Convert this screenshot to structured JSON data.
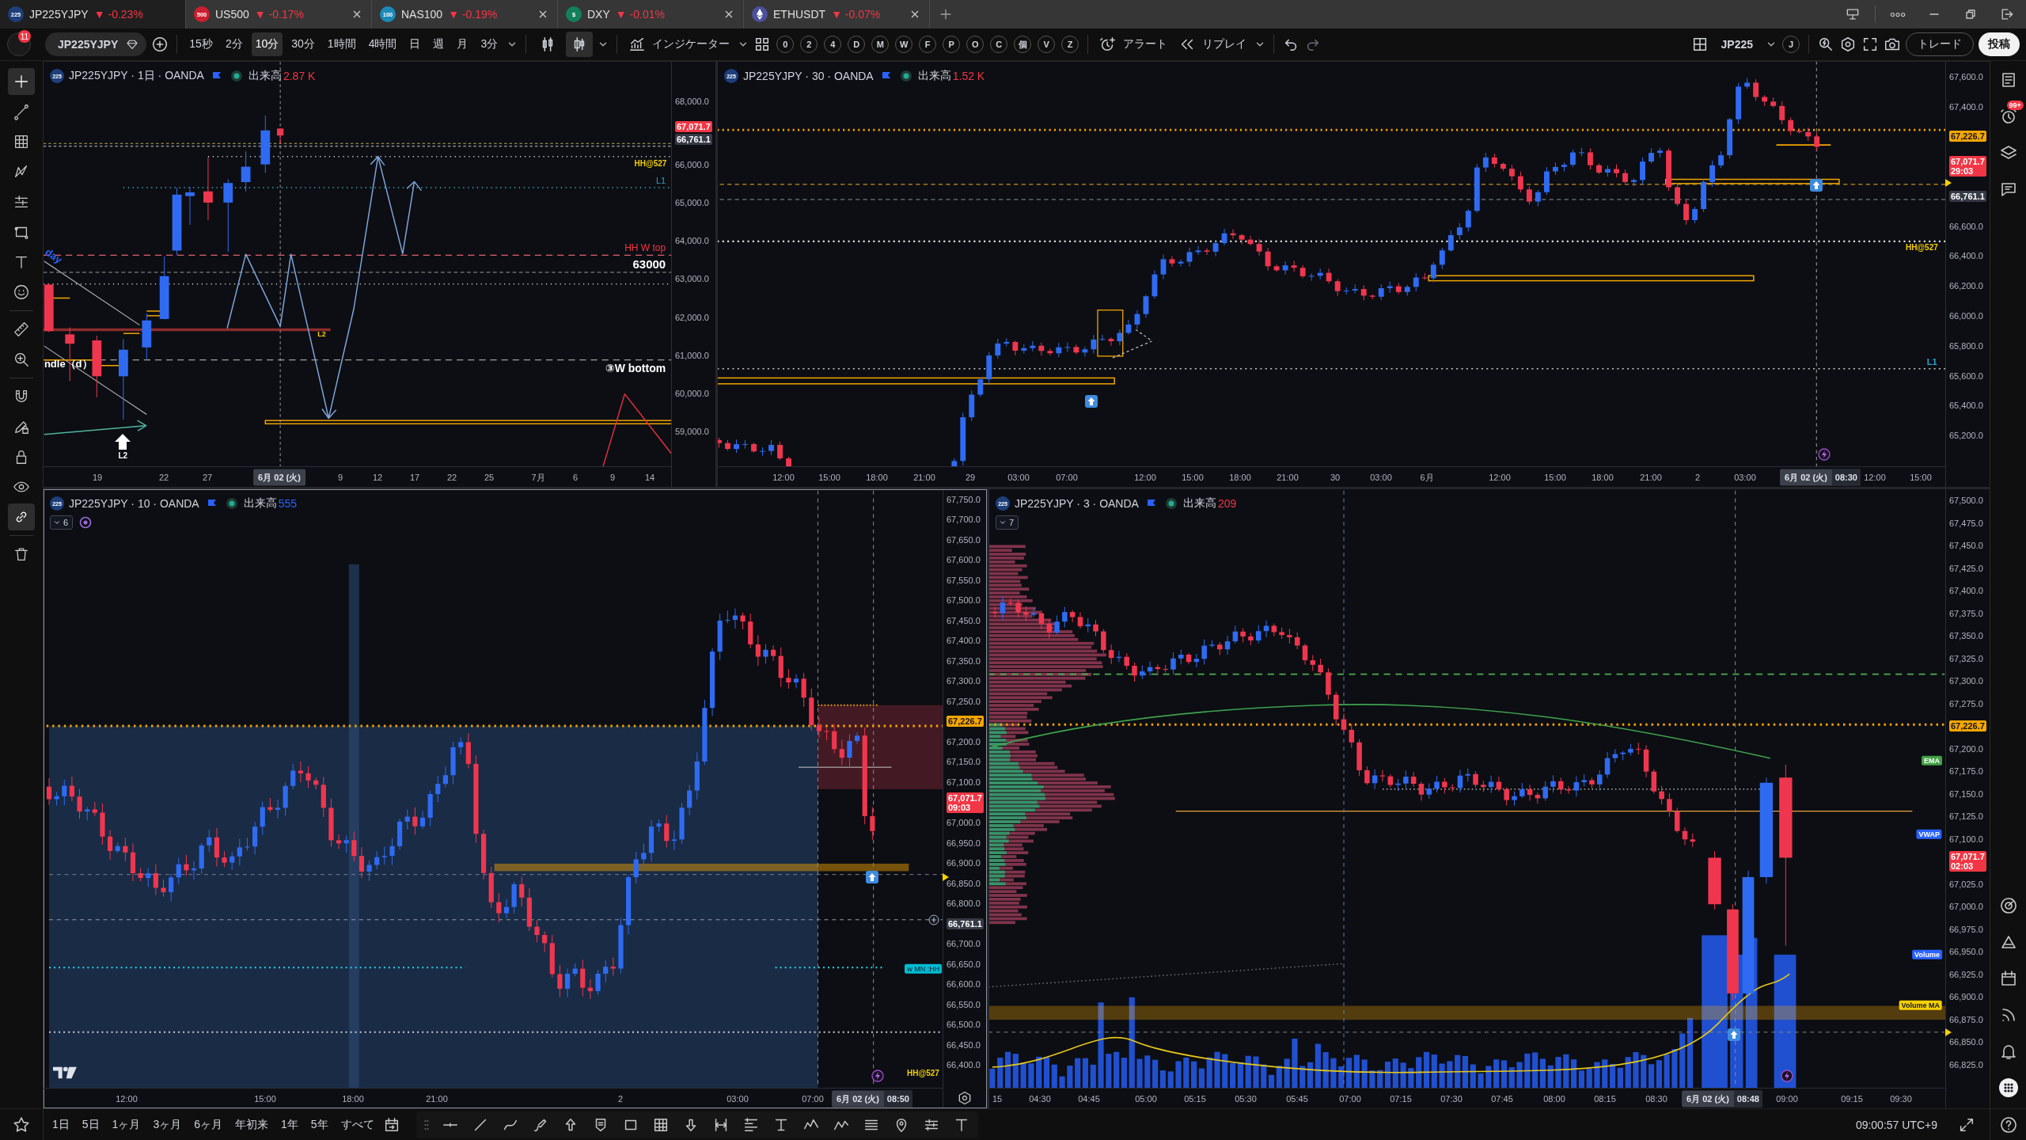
{
  "tabs": [
    {
      "kind": "text",
      "badge": "225",
      "symbol": "JP225YJPY",
      "change": "▼ -0.23%",
      "color": "#1e3f7a",
      "selected": true
    },
    {
      "kind": "text",
      "badge": "500",
      "symbol": "US500",
      "change": "▼ -0.17%",
      "color": "#cc1f2f",
      "selected": false
    },
    {
      "kind": "text",
      "badge": "100",
      "symbol": "NAS100",
      "change": "▼ -0.19%",
      "color": "#1c8ab8",
      "selected": false
    },
    {
      "kind": "text",
      "badge": "$",
      "symbol": "DXY",
      "change": "▼ -0.01%",
      "color": "#13805a",
      "selected": false
    },
    {
      "kind": "icon",
      "symbol": "ETHUSDT",
      "change": "▼ -0.07%",
      "color": "#4b4f9c",
      "selected": false
    }
  ],
  "toolbar": {
    "notifications": "11",
    "symbol": "JP225YJPY",
    "intervals": [
      {
        "label": "15秒",
        "selected": false
      },
      {
        "label": "2分",
        "selected": false
      },
      {
        "label": "10分",
        "selected": true
      },
      {
        "label": "30分",
        "selected": false
      },
      {
        "label": "1時間",
        "selected": false
      },
      {
        "label": "4時間",
        "selected": false
      },
      {
        "label": "日",
        "selected": false
      },
      {
        "label": "週",
        "selected": false
      },
      {
        "label": "月",
        "selected": false
      },
      {
        "label": "3分",
        "selected": false
      }
    ],
    "chart_styles": [
      {
        "selected": false
      },
      {
        "selected": true
      }
    ],
    "indicators": "インジケーター",
    "shortcuts": [
      "0",
      "2",
      "4",
      "D",
      "M",
      "W",
      "F",
      "P",
      "O",
      "C",
      "個",
      "V",
      "Z"
    ],
    "alert": "アラート",
    "replay": "リプレイ",
    "layout_symbol": "JP225",
    "layout_badge": "J",
    "trade": "トレード",
    "publish": "投稿"
  },
  "left_tools": [
    {
      "selected": true
    },
    {
      "selected": false
    },
    {
      "selected": false
    },
    {
      "selected": false
    },
    {
      "selected": false
    },
    {
      "selected": false
    },
    {
      "selected": false
    },
    {
      "selected": false
    },
    {
      "selected": false
    },
    {
      "selected": false
    },
    {
      "selected": false
    },
    {
      "selected": false
    },
    {
      "selected": false
    },
    {
      "selected": false
    },
    {
      "selected": true
    },
    {
      "selected": false
    }
  ],
  "panes": [
    {
      "badge": "225",
      "title": "JP225YJPY · 1日 · OANDA",
      "volume": {
        "label": "出来高",
        "value": "2.87 K",
        "color": "#f23645"
      },
      "selected": false,
      "price_axis": [
        {
          "kind": "tick",
          "text": "68,000.0"
        },
        {
          "kind": "tag",
          "text": "67,071.7",
          "color": "#f23645"
        },
        {
          "kind": "tag",
          "text": "66,761.1",
          "color": "#363a45"
        },
        {
          "kind": "tick",
          "text": "66,000.0"
        },
        {
          "kind": "tick",
          "text": "65,000.0"
        },
        {
          "kind": "tick",
          "text": "64,000.0"
        },
        {
          "kind": "tick",
          "text": "63,000.0"
        },
        {
          "kind": "tick",
          "text": "62,000.0"
        },
        {
          "kind": "tick",
          "text": "61,000.0"
        },
        {
          "kind": "tick",
          "text": "60,000.0"
        },
        {
          "kind": "tick",
          "text": "59,000.0"
        }
      ],
      "time_axis": [
        {
          "kind": "tick",
          "text": "19"
        },
        {
          "kind": "tick",
          "text": "22"
        },
        {
          "kind": "tick",
          "text": "27"
        },
        {
          "kind": "cursor",
          "text": "6月 02 (火)"
        },
        {
          "kind": "tick",
          "text": "9"
        },
        {
          "kind": "tick",
          "text": "12"
        },
        {
          "kind": "tick",
          "text": "17"
        },
        {
          "kind": "tick",
          "text": "22"
        },
        {
          "kind": "tick",
          "text": "25"
        },
        {
          "kind": "tick",
          "text": "7月"
        },
        {
          "kind": "tick",
          "text": "6"
        },
        {
          "kind": "tick",
          "text": "9"
        },
        {
          "kind": "tick",
          "text": "14"
        }
      ],
      "annotations": [
        {
          "kind": "text",
          "text": "HH@527",
          "color": "#f5d000"
        },
        {
          "kind": "text",
          "text": "L1",
          "color": "#26a6c9"
        },
        {
          "kind": "text",
          "text": "HH W top",
          "color": "#f23645"
        },
        {
          "kind": "text",
          "text": "63000",
          "color": "#ffffff"
        },
        {
          "kind": "text",
          "text": "L2",
          "color": "#f5d000"
        },
        {
          "kind": "text",
          "text": "③W bottom",
          "color": "#ffffff"
        },
        {
          "kind": "text",
          "text": "ndle（d）",
          "color": "#ffffff"
        },
        {
          "kind": "text",
          "text": "L2",
          "color": "#ffffff"
        },
        {
          "kind": "text",
          "text": "day",
          "color": "#2962ff"
        }
      ]
    },
    {
      "badge": "225",
      "title": "JP225YJPY · 30 · OANDA",
      "volume": {
        "label": "出来高",
        "value": "1.52 K",
        "color": "#f23645"
      },
      "selected": false,
      "price_axis": [
        {
          "kind": "tick",
          "text": "67,600.0"
        },
        {
          "kind": "tick",
          "text": "67,400.0"
        },
        {
          "kind": "tag",
          "text": "67,226.7",
          "color": "#f7a600"
        },
        {
          "kind": "tag",
          "text": "67,071.7",
          "sub": "29:03",
          "color": "#f23645"
        },
        {
          "kind": "tag",
          "text": "66,761.1",
          "color": "#363a45"
        },
        {
          "kind": "tick",
          "text": "66,600.0"
        },
        {
          "kind": "tick",
          "text": "66,400.0"
        },
        {
          "kind": "tick",
          "text": "66,200.0"
        },
        {
          "kind": "tick",
          "text": "66,000.0"
        },
        {
          "kind": "tick",
          "text": "65,800.0"
        },
        {
          "kind": "tick",
          "text": "65,600.0"
        },
        {
          "kind": "tick",
          "text": "65,400.0"
        },
        {
          "kind": "tick",
          "text": "65,200.0"
        }
      ],
      "time_axis": [
        {
          "kind": "tick",
          "text": "12:00"
        },
        {
          "kind": "tick",
          "text": "15:00"
        },
        {
          "kind": "tick",
          "text": "18:00"
        },
        {
          "kind": "tick",
          "text": "21:00"
        },
        {
          "kind": "tick",
          "text": "29"
        },
        {
          "kind": "tick",
          "text": "03:00"
        },
        {
          "kind": "tick",
          "text": "07:00"
        },
        {
          "kind": "tick",
          "text": "12:00"
        },
        {
          "kind": "tick",
          "text": "15:00"
        },
        {
          "kind": "tick",
          "text": "18:00"
        },
        {
          "kind": "tick",
          "text": "21:00"
        },
        {
          "kind": "tick",
          "text": "30"
        },
        {
          "kind": "tick",
          "text": "03:00"
        },
        {
          "kind": "tick",
          "text": "6月"
        },
        {
          "kind": "tick",
          "text": "12:00"
        },
        {
          "kind": "tick",
          "text": "15:00"
        },
        {
          "kind": "tick",
          "text": "18:00"
        },
        {
          "kind": "tick",
          "text": "21:00"
        },
        {
          "kind": "tick",
          "text": "2"
        },
        {
          "kind": "tick",
          "text": "03:00"
        },
        {
          "kind": "cursor",
          "text": "6月 02 (火)",
          "time": "08:30"
        },
        {
          "kind": "tick",
          "text": "12:00"
        },
        {
          "kind": "tick",
          "text": "15:00"
        }
      ],
      "annotations": [
        {
          "kind": "text",
          "text": "HH@527",
          "color": "#f5d000"
        },
        {
          "kind": "text",
          "text": "L1",
          "color": "#26a6c9"
        }
      ]
    },
    {
      "badge": "225",
      "title": "JP225YJPY · 10 · OANDA",
      "volume": {
        "label": "出来高",
        "value": "555",
        "color": "#2962ff"
      },
      "indicator_count": "6",
      "selected": true,
      "price_axis": [
        {
          "kind": "tick",
          "text": "67,750.0"
        },
        {
          "kind": "tick",
          "text": "67,700.0"
        },
        {
          "kind": "tick",
          "text": "67,650.0"
        },
        {
          "kind": "tick",
          "text": "67,600.0"
        },
        {
          "kind": "tick",
          "text": "67,550.0"
        },
        {
          "kind": "tick",
          "text": "67,500.0"
        },
        {
          "kind": "tick",
          "text": "67,450.0"
        },
        {
          "kind": "tick",
          "text": "67,400.0"
        },
        {
          "kind": "tick",
          "text": "67,350.0"
        },
        {
          "kind": "tick",
          "text": "67,300.0"
        },
        {
          "kind": "tick",
          "text": "67,250.0"
        },
        {
          "kind": "tag",
          "text": "67,226.7",
          "color": "#f7a600"
        },
        {
          "kind": "tick",
          "text": "67,200.0"
        },
        {
          "kind": "tick",
          "text": "67,150.0"
        },
        {
          "kind": "tick",
          "text": "67,100.0"
        },
        {
          "kind": "tag",
          "text": "67,071.7",
          "sub": "09:03",
          "color": "#f23645"
        },
        {
          "kind": "tick",
          "text": "67,000.0"
        },
        {
          "kind": "tick",
          "text": "66,950.0"
        },
        {
          "kind": "tick",
          "text": "66,900.0"
        },
        {
          "kind": "tick",
          "text": "66,850.0"
        },
        {
          "kind": "tick",
          "text": "66,800.0"
        },
        {
          "kind": "tag",
          "text": "66,761.1",
          "color": "#363a45"
        },
        {
          "kind": "tick",
          "text": "66,700.0"
        },
        {
          "kind": "tick",
          "text": "66,650.0"
        },
        {
          "kind": "tick",
          "text": "66,600.0"
        },
        {
          "kind": "tick",
          "text": "66,550.0"
        },
        {
          "kind": "tick",
          "text": "66,500.0"
        },
        {
          "kind": "tick",
          "text": "66,450.0"
        },
        {
          "kind": "tick",
          "text": "66,400.0"
        }
      ],
      "time_axis": [
        {
          "kind": "tick",
          "text": "12:00"
        },
        {
          "kind": "tick",
          "text": "15:00"
        },
        {
          "kind": "tick",
          "text": "18:00"
        },
        {
          "kind": "tick",
          "text": "21:00"
        },
        {
          "kind": "tick",
          "text": "2"
        },
        {
          "kind": "tick",
          "text": "03:00"
        },
        {
          "kind": "tick",
          "text": "07:00"
        },
        {
          "kind": "cursor",
          "text": "6月 02 (火)",
          "time": "08:50"
        }
      ],
      "annotations": [
        {
          "kind": "tag",
          "text": "w MN :HH",
          "color": "#00bcd4"
        },
        {
          "kind": "text",
          "text": "HH@527",
          "color": "#f5d000"
        }
      ]
    },
    {
      "badge": "225",
      "title": "JP225YJPY · 3 · OANDA",
      "volume": {
        "label": "出来高",
        "value": "209",
        "color": "#f23645"
      },
      "indicator_count": "7",
      "selected": false,
      "price_axis": [
        {
          "kind": "tick",
          "text": "67,500.0"
        },
        {
          "kind": "tick",
          "text": "67,475.0"
        },
        {
          "kind": "tick",
          "text": "67,450.0"
        },
        {
          "kind": "tick",
          "text": "67,425.0"
        },
        {
          "kind": "tick",
          "text": "67,400.0"
        },
        {
          "kind": "tick",
          "text": "67,375.0"
        },
        {
          "kind": "tick",
          "text": "67,350.0"
        },
        {
          "kind": "tick",
          "text": "67,325.0"
        },
        {
          "kind": "tick",
          "text": "67,300.0"
        },
        {
          "kind": "tick",
          "text": "67,275.0"
        },
        {
          "kind": "tag",
          "text": "67,226.7",
          "color": "#f7a600"
        },
        {
          "kind": "tick",
          "text": "67,200.0"
        },
        {
          "kind": "tick",
          "text": "67,175.0"
        },
        {
          "kind": "tick",
          "text": "67,150.0"
        },
        {
          "kind": "tick",
          "text": "67,125.0"
        },
        {
          "kind": "tick",
          "text": "67,100.0"
        },
        {
          "kind": "tag",
          "text": "67,071.7",
          "sub": "02:03",
          "color": "#f23645"
        },
        {
          "kind": "tick",
          "text": "67,025.0"
        },
        {
          "kind": "tick",
          "text": "67,000.0"
        },
        {
          "kind": "tick",
          "text": "66,975.0"
        },
        {
          "kind": "tick",
          "text": "66,950.0"
        },
        {
          "kind": "tick",
          "text": "66,925.0"
        },
        {
          "kind": "tick",
          "text": "66,900.0"
        },
        {
          "kind": "tick",
          "text": "66,875.0"
        },
        {
          "kind": "tick",
          "text": "66,850.0"
        },
        {
          "kind": "tick",
          "text": "66,825.0"
        }
      ],
      "time_axis": [
        {
          "kind": "tick",
          "text": "15"
        },
        {
          "kind": "tick",
          "text": "04:30"
        },
        {
          "kind": "tick",
          "text": "04:45"
        },
        {
          "kind": "tick",
          "text": "05:00"
        },
        {
          "kind": "tick",
          "text": "05:15"
        },
        {
          "kind": "tick",
          "text": "05:30"
        },
        {
          "kind": "tick",
          "text": "05:45"
        },
        {
          "kind": "tick",
          "text": "07:00"
        },
        {
          "kind": "tick",
          "text": "07:15"
        },
        {
          "kind": "tick",
          "text": "07:30"
        },
        {
          "kind": "tick",
          "text": "07:45"
        },
        {
          "kind": "tick",
          "text": "08:00"
        },
        {
          "kind": "tick",
          "text": "08:15"
        },
        {
          "kind": "tick",
          "text": "08:30"
        },
        {
          "kind": "cursor",
          "text": "6月 02 (火)",
          "time": "08:48"
        },
        {
          "kind": "tick",
          "text": "09:00"
        },
        {
          "kind": "tick",
          "text": "09:15"
        },
        {
          "kind": "tick",
          "text": "09:30"
        }
      ],
      "annotations": [
        {
          "kind": "tag",
          "text": "EMA",
          "color": "#43a047"
        },
        {
          "kind": "tag",
          "text": "VWAP",
          "color": "#2962ff"
        },
        {
          "kind": "tag",
          "text": "Volume",
          "color": "#2962ff"
        },
        {
          "kind": "tag",
          "text": "Volume MA",
          "color": "#f5d000"
        }
      ]
    }
  ],
  "right_sidebar": {
    "alerts_badge": "99+"
  },
  "bottom_bar": {
    "ranges": [
      "1日",
      "5日",
      "1ヶ月",
      "3ヶ月",
      "6ヶ月",
      "年初来",
      "1年",
      "5年",
      "すべて"
    ],
    "clock": "09:00:57 UTC+9"
  }
}
